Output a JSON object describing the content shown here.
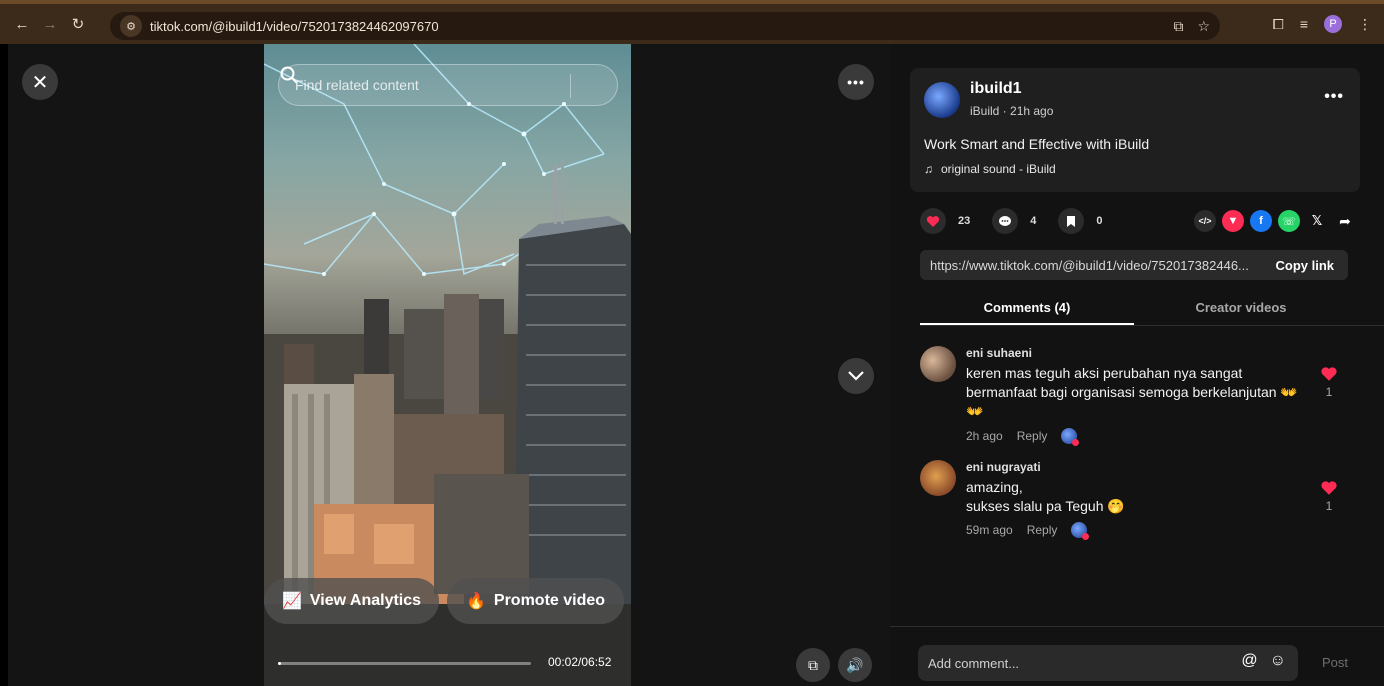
{
  "browser": {
    "url": "tiktok.com/@ibuild1/video/7520173824462097670",
    "profile_initial": "P"
  },
  "video": {
    "search_placeholder": "Find related content",
    "view_analytics_label": "View Analytics",
    "promote_label": "Promote video",
    "time": "00:02/06:52",
    "progress": 0.005
  },
  "post": {
    "author": "ibuild1",
    "author_sub": "iBuild · 21h ago",
    "caption": "Work Smart and Effective with iBuild",
    "sound": "original sound - iBuild",
    "likes": "23",
    "comments": "4",
    "saves": "0",
    "link": "https://www.tiktok.com/@ibuild1/video/752017382446...",
    "copy_label": "Copy link"
  },
  "tabs": {
    "comments": "Comments (4)",
    "creator_videos": "Creator videos"
  },
  "comments": [
    {
      "user": "eni suhaeni",
      "text": "keren mas teguh aksi perubahan nya sangat bermanfaat bagi organisasi semoga berkelanjutan 👐👐",
      "time": "2h ago",
      "reply": "Reply",
      "likes": "1"
    },
    {
      "user": "eni nugrayati",
      "text_line1": "amazing,",
      "text_line2": "sukses slalu pa Teguh 🤭",
      "time": "59m ago",
      "reply": "Reply",
      "likes": "1"
    }
  ],
  "composer": {
    "placeholder": "Add comment...",
    "post_label": "Post"
  },
  "colors": {
    "like_red": "#fe2c55",
    "panel_bg": "#121212",
    "browser_bar": "#3c2a1a"
  }
}
